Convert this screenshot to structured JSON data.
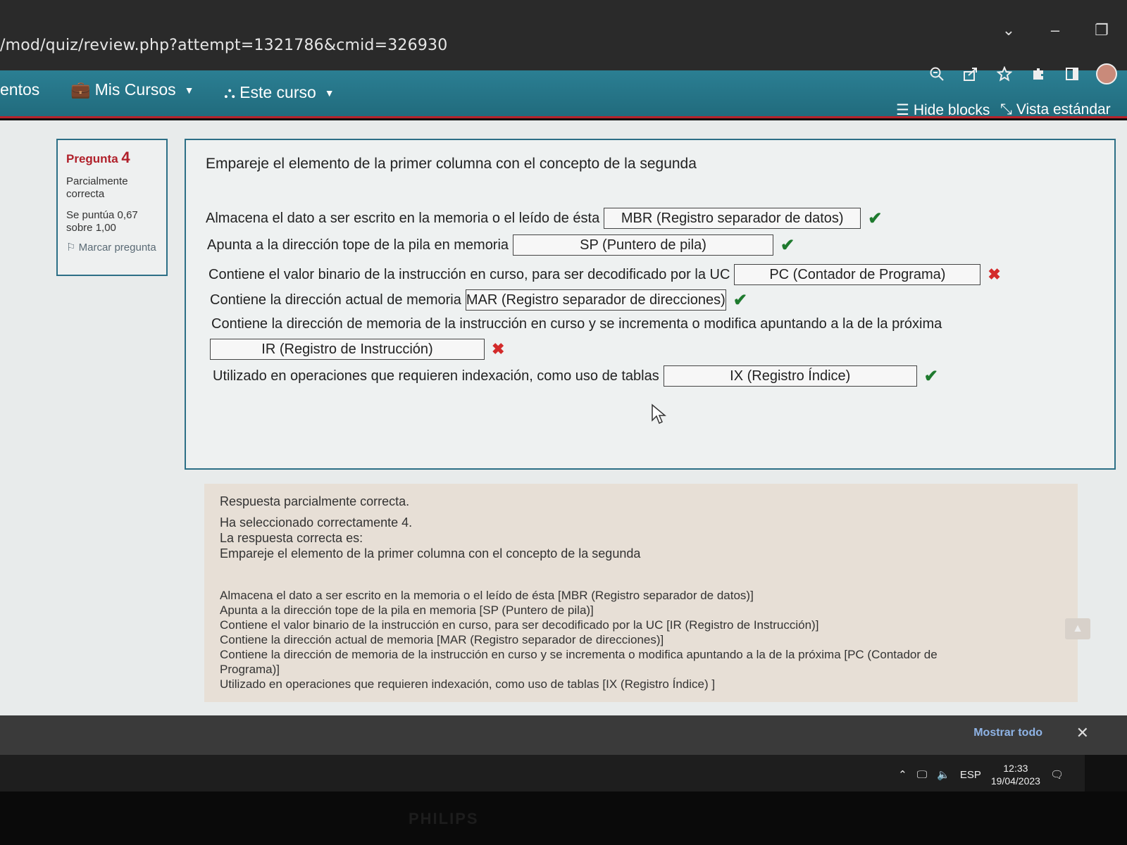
{
  "browser": {
    "address": "/mod/quiz/review.php?attempt=1321786&cmid=326930",
    "icons": [
      "zoom-icon",
      "share-icon",
      "star-icon",
      "extensions-icon",
      "sidebar-icon"
    ]
  },
  "navbar": {
    "left_partial": "entos",
    "mis_cursos": "Mis Cursos",
    "este_curso": "Este curso",
    "hide_blocks": "Hide blocks",
    "vista_estandar": "Vista estándar"
  },
  "question_info": {
    "label": "Pregunta",
    "number": "4",
    "state": "Parcialmente correcta",
    "grade": "Se puntúa 0,67 sobre 1,00",
    "flag": "Marcar pregunta"
  },
  "question": {
    "text": "Empareje el elemento de la primer columna con el concepto de la segunda",
    "items": [
      {
        "stem": "Almacena el dato a ser escrito en la memoria o el leído de ésta",
        "answer": "MBR (Registro separador de datos)",
        "correct": true
      },
      {
        "stem": "Apunta a la dirección tope de la pila en memoria",
        "answer": "SP (Puntero de pila)",
        "correct": true
      },
      {
        "stem": "Contiene el valor binario de la instrucción en curso, para ser decodificado por la UC",
        "answer": "PC (Contador de Programa)",
        "correct": false
      },
      {
        "stem": "Contiene la dirección actual de memoria",
        "answer": "MAR (Registro separador de direcciones)",
        "correct": true
      },
      {
        "stem": "Contiene la dirección de memoria de la instrucción en curso y se incrementa o modifica apuntando a la de la próxima",
        "answer": "IR (Registro de Instrucción)",
        "correct": false
      },
      {
        "stem": "Utilizado en operaciones que requieren indexación, como uso de tablas",
        "answer": "IX (Registro Índice)",
        "correct": true
      }
    ]
  },
  "feedback": {
    "line1": "Respuesta parcialmente correcta.",
    "line2": "Ha seleccionado correctamente 4.",
    "line3": "La respuesta correcta es:",
    "line4": "Empareje el elemento de la primer columna con el concepto de la segunda",
    "answers": [
      "Almacena el dato a ser escrito en la memoria o el leído de ésta [MBR (Registro separador de datos)]",
      "Apunta a la dirección tope de la pila en memoria [SP (Puntero de pila)]",
      "Contiene el valor binario de la instrucción en curso, para ser decodificado por la UC [IR (Registro de Instrucción)]",
      "Contiene la dirección actual de memoria [MAR (Registro separador de direcciones)]",
      "Contiene la dirección de memoria de la instrucción en curso y se incrementa o modifica apuntando a la de la próxima [PC (Contador de",
      "Programa)]",
      "Utilizado en operaciones que requieren indexación, como uso de tablas [IX (Registro Índice) ]"
    ]
  },
  "downloads": {
    "show_all": "Mostrar todo",
    "close": "✕"
  },
  "taskbar": {
    "lang": "ESP",
    "time": "12:33",
    "date": "19/04/2023"
  },
  "monitor": {
    "brand": "PHILIPS"
  },
  "colors": {
    "navbar": "#2b7f93",
    "accent_red": "#b8232b",
    "correct": "#1e7a2e",
    "incorrect": "#d32a2a"
  }
}
